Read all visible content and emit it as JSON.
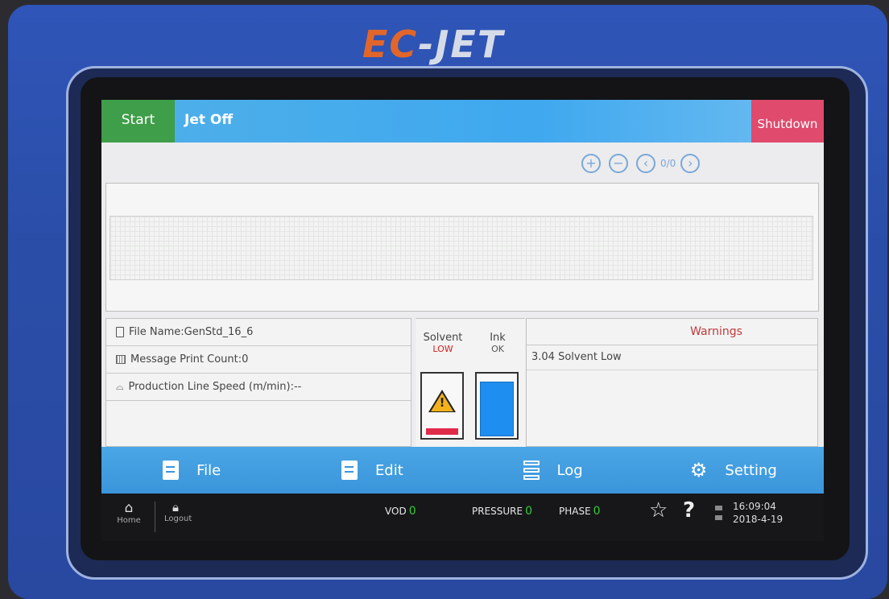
{
  "brand": {
    "prefix": "EC",
    "suffix": "-JET"
  },
  "topbar": {
    "start_label": "Start",
    "jet_status": "Jet Off",
    "shutdown_label": "Shutdown"
  },
  "preview": {
    "zoom_in_icon": "zoom-in-icon",
    "zoom_out_icon": "zoom-out-icon",
    "page_indicator": "0/0"
  },
  "info": {
    "file_name": "File Name:GenStd_16_6",
    "print_count": "Message Print Count:0",
    "line_speed": "Production Line Speed (m/min):--"
  },
  "solvent": {
    "label": "Solvent",
    "status": "LOW",
    "status_color": "#d32020",
    "level_fraction": 0.1
  },
  "ink": {
    "label": "Ink",
    "status": "OK",
    "level_color": "#1e8ef0",
    "level_fraction": 0.85
  },
  "warnings": {
    "title": "Warnings",
    "items": [
      "3.04 Solvent Low"
    ]
  },
  "menu": {
    "file": "File",
    "edit": "Edit",
    "log": "Log",
    "setting": "Setting"
  },
  "statusbar": {
    "home": "Home",
    "logout": "Logout",
    "vod_label": "VOD",
    "vod_value": "0",
    "pressure_label": "PRESSURE",
    "pressure_value": "0",
    "phase_label": "PHASE",
    "phase_value": "0",
    "time": "16:09:04",
    "date": "2018-4-19"
  }
}
